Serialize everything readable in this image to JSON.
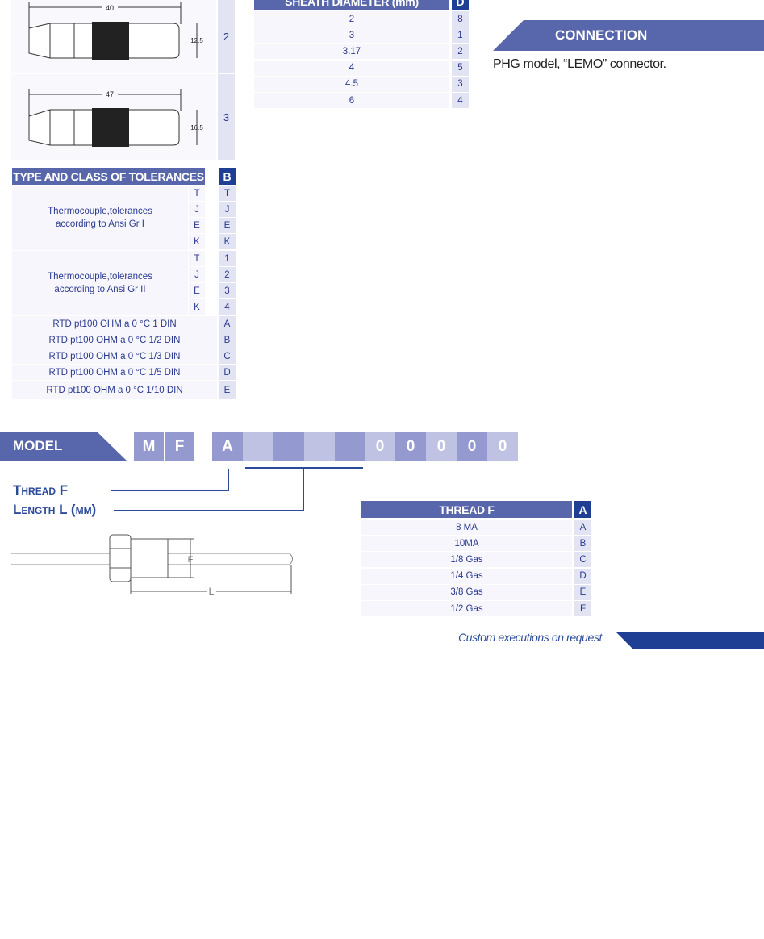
{
  "connectors": [
    {
      "code": "2",
      "length": "40",
      "diameter": "12.5"
    },
    {
      "code": "3",
      "length": "47",
      "diameter": "16.5"
    }
  ],
  "tolerances": {
    "header": "TYPE AND CLASS OF TOLERANCES",
    "badge": "B",
    "groups": [
      {
        "label_line1": "Thermocouple,tolerances",
        "label_line2": "according to Ansi Gr I",
        "types": [
          "T",
          "J",
          "E",
          "K"
        ],
        "codes": [
          "T",
          "J",
          "E",
          "K"
        ]
      },
      {
        "label_line1": "Thermocouple,tolerances",
        "label_line2": "according to Ansi Gr II",
        "types": [
          "T",
          "J",
          "E",
          "K"
        ],
        "codes": [
          "1",
          "2",
          "3",
          "4"
        ]
      }
    ],
    "rtd": [
      {
        "label": "RTD pt100 OHM a 0 °C 1 DIN",
        "code": "A"
      },
      {
        "label": "RTD pt100 OHM a 0 °C 1/2 DIN",
        "code": "B"
      },
      {
        "label": "RTD pt100 OHM a 0 °C 1/3 DIN",
        "code": "C"
      },
      {
        "label": "RTD pt100 OHM a 0 °C 1/5 DIN",
        "code": "D"
      },
      {
        "label": "RTD pt100 OHM a 0 °C 1/10 DIN",
        "code": "E"
      }
    ]
  },
  "sheath": {
    "header": "SHEATH DIAMETER (mm)",
    "badge": "D",
    "rows": [
      {
        "value": "2",
        "code": "8"
      },
      {
        "value": "3",
        "code": "1"
      },
      {
        "value": "3.17",
        "code": "2"
      },
      {
        "value": "4",
        "code": "5"
      },
      {
        "value": "4.5",
        "code": "3"
      },
      {
        "value": "6",
        "code": "4"
      }
    ]
  },
  "connection": {
    "title": "CONNECTION",
    "text": "PHG model, “LEMO” connector."
  },
  "model": {
    "label": "MODEL",
    "boxes": [
      "M",
      "F",
      "A",
      "",
      "",
      "",
      "",
      "0",
      "0",
      "0",
      "0",
      "0"
    ]
  },
  "legend": {
    "thread": "Thread F",
    "length": "Length L (mm)"
  },
  "drawing": {
    "f_label": "F",
    "l_label": "L"
  },
  "thread": {
    "header": "THREAD F",
    "badge": "A",
    "rows": [
      {
        "value": "8 MA",
        "code": "A"
      },
      {
        "value": "10MA",
        "code": "B"
      },
      {
        "value": "1/8 Gas",
        "code": "C"
      },
      {
        "value": "1/4 Gas",
        "code": "D"
      },
      {
        "value": "3/8 Gas",
        "code": "E"
      },
      {
        "value": "1/2 Gas",
        "code": "F"
      }
    ]
  },
  "footer": {
    "note": "Custom executions on request"
  },
  "colors": {
    "header": "#5866ab",
    "badge": "#1f3f94",
    "box_medium": "#9499cf",
    "box_light": "#c0c2e3",
    "text": "#2b3a8f"
  }
}
